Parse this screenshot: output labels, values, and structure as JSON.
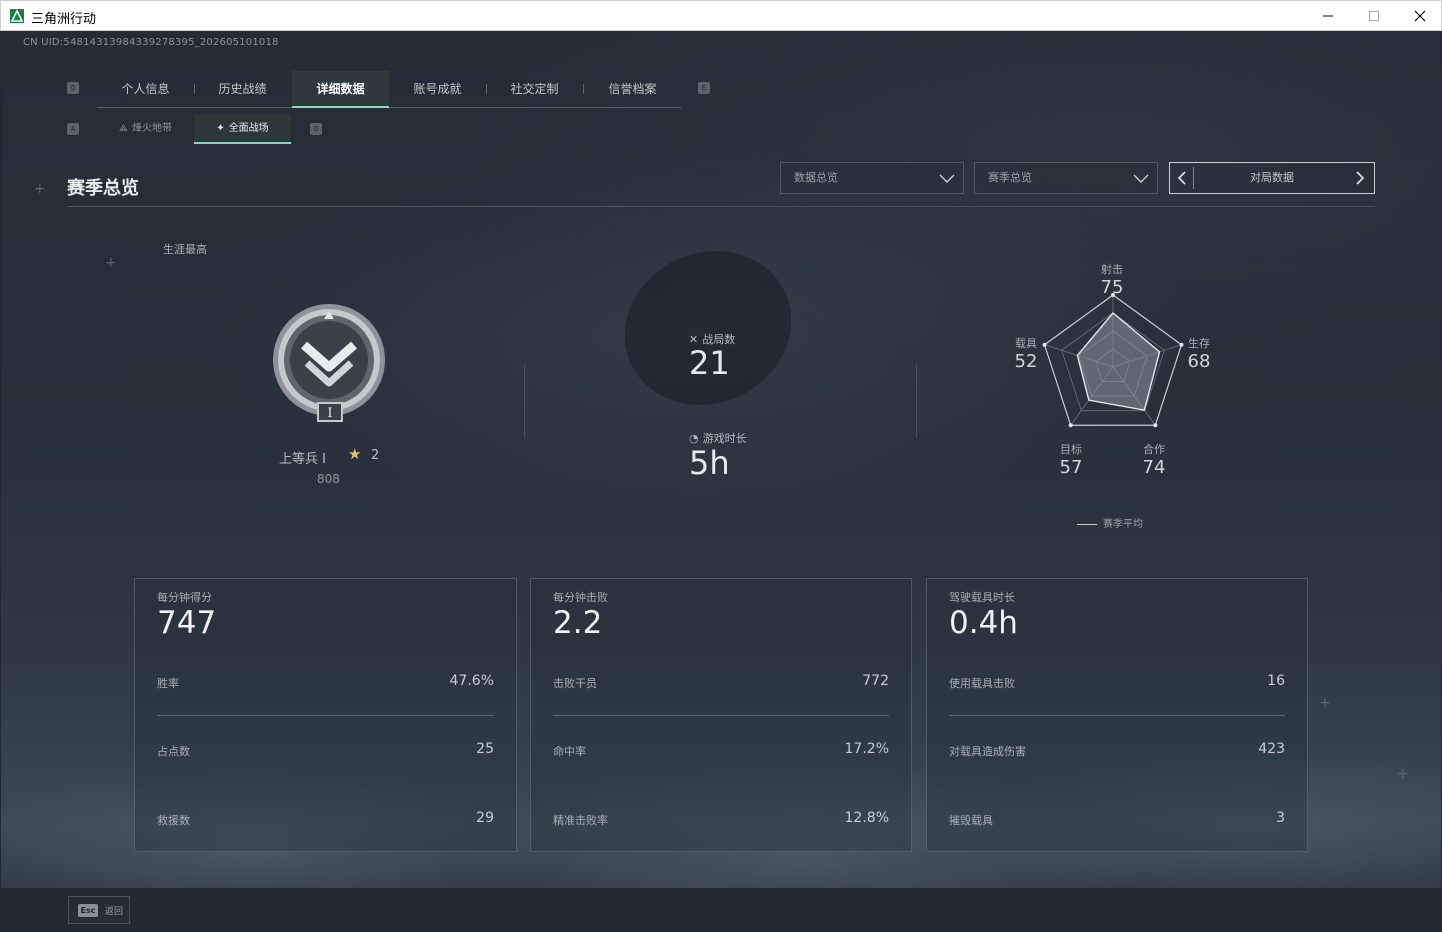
{
  "window": {
    "title": "三角洲行动"
  },
  "uid": "CN UID:548143139843392783​95_202605101018",
  "tabs": {
    "left_key": "Q",
    "right_key": "E",
    "items": [
      "个人信息",
      "历史战绩",
      "详细数据",
      "账号成就",
      "社交定制",
      "信誉档案"
    ],
    "active_index": 2
  },
  "subtabs": {
    "left_key": "A",
    "right_key": "D",
    "items": [
      "烽火地带",
      "全面战场"
    ],
    "active_index": 1
  },
  "section": {
    "title": "赛季总览"
  },
  "filters": {
    "dropdown1": "数据总览",
    "dropdown2": "赛季总览",
    "pager_label": "对局数据"
  },
  "career": {
    "label": "生涯最高",
    "rank_name": "上等兵 I",
    "stars": "2",
    "score": "808",
    "badge_roman": "I"
  },
  "mid": {
    "matches_label": "战局数",
    "matches_value": "21",
    "time_label": "游戏时长",
    "time_value": "5h"
  },
  "radar": {
    "axes": [
      {
        "label": "射击",
        "value": 75
      },
      {
        "label": "生存",
        "value": 68
      },
      {
        "label": "合作",
        "value": 74
      },
      {
        "label": "目标",
        "value": 57
      },
      {
        "label": "载具",
        "value": 52
      }
    ],
    "legend": "赛季平均"
  },
  "cards": [
    {
      "head_label": "每分钟得分",
      "head_value": "747",
      "rows": [
        {
          "k": "胜率",
          "v": "47.6%"
        },
        {
          "k": "占点数",
          "v": "25"
        },
        {
          "k": "救援数",
          "v": "29"
        }
      ]
    },
    {
      "head_label": "每分钟击败",
      "head_value": "2.2",
      "rows": [
        {
          "k": "击败干员",
          "v": "772"
        },
        {
          "k": "命中率",
          "v": "17.2%"
        },
        {
          "k": "精准击败率",
          "v": "12.8%"
        }
      ]
    },
    {
      "head_label": "驾驶载具时长",
      "head_value": "0.4h",
      "rows": [
        {
          "k": "使用载具击败",
          "v": "16"
        },
        {
          "k": "对载具造成伤害",
          "v": "423"
        },
        {
          "k": "摧毁载具",
          "v": "3"
        }
      ]
    }
  ],
  "footer": {
    "esc_key": "Esc",
    "back_label": "返回"
  },
  "colors": {
    "accent": "#8fd6b6",
    "star": "#e3c26c"
  }
}
